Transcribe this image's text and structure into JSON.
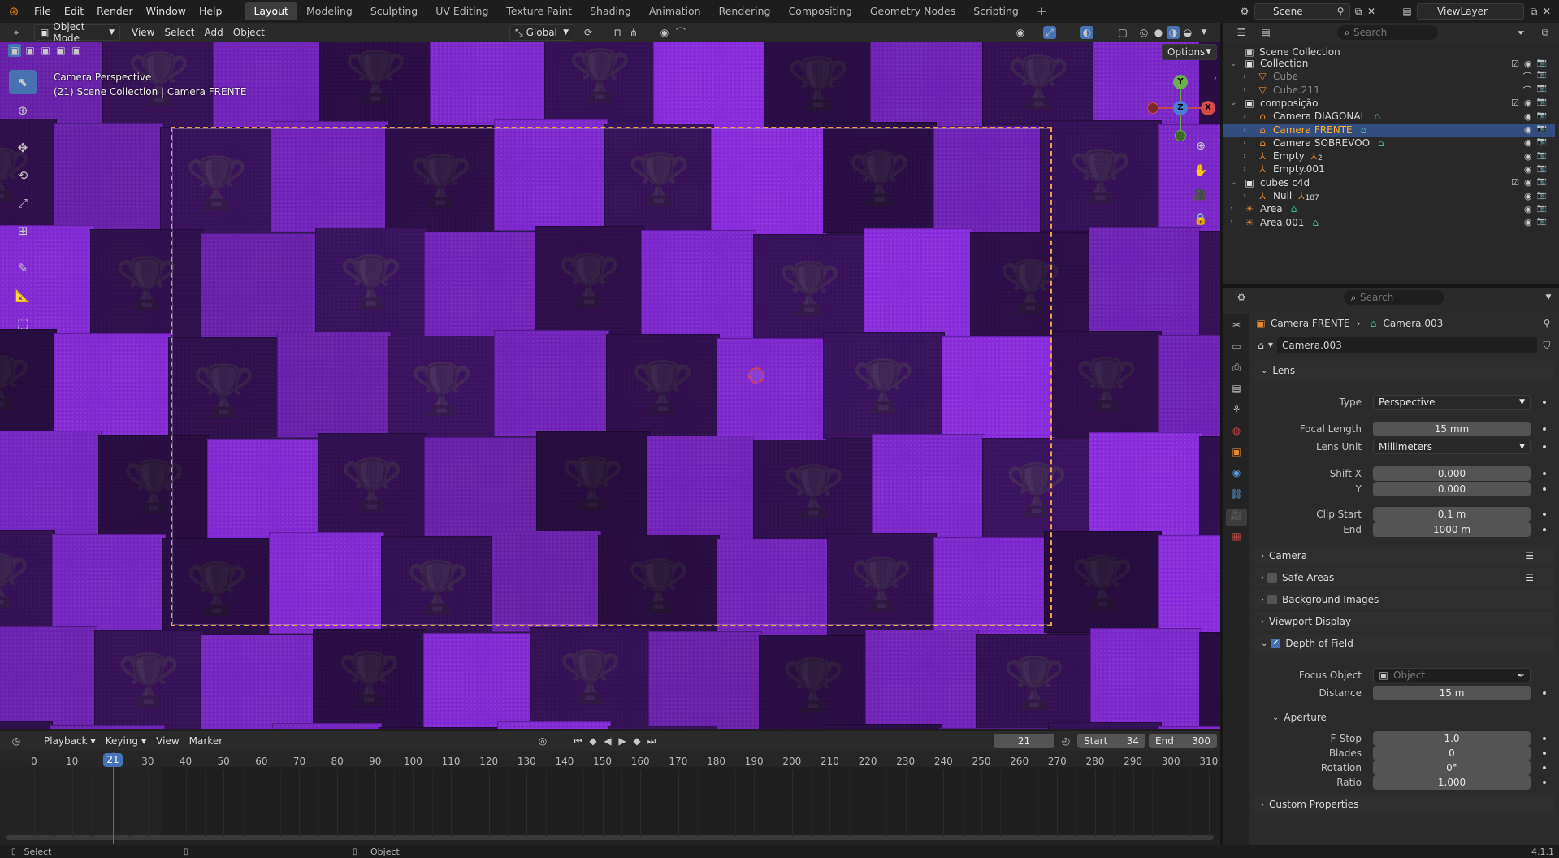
{
  "menubar": {
    "items": [
      "File",
      "Edit",
      "Render",
      "Window",
      "Help"
    ],
    "workspaces": [
      "Layout",
      "Modeling",
      "Sculpting",
      "UV Editing",
      "Texture Paint",
      "Shading",
      "Animation",
      "Rendering",
      "Compositing",
      "Geometry Nodes",
      "Scripting"
    ],
    "active_workspace": "Layout",
    "scene": "Scene",
    "view_layer": "ViewLayer"
  },
  "viewport_header": {
    "mode": "Object Mode",
    "menus": [
      "View",
      "Select",
      "Add",
      "Object"
    ],
    "transform_orientation": "Global",
    "options": "Options"
  },
  "viewport": {
    "overlay_title": "Camera Perspective",
    "overlay_subtitle": "(21) Scene Collection | Camera FRENTE",
    "gizmo_axes": [
      "X",
      "Y",
      "Z"
    ]
  },
  "outliner": {
    "search_placeholder": "Search",
    "root": "Scene Collection",
    "items": [
      {
        "label": "Collection",
        "depth": 1,
        "type": "collection"
      },
      {
        "label": "Cube",
        "depth": 2,
        "type": "mesh",
        "dim": true
      },
      {
        "label": "Cube.211",
        "depth": 2,
        "type": "mesh",
        "dim": true
      },
      {
        "label": "composição",
        "depth": 1,
        "type": "collection"
      },
      {
        "label": "Camera DIAGONAL",
        "depth": 2,
        "type": "camera"
      },
      {
        "label": "Camera FRENTE",
        "depth": 2,
        "type": "camera",
        "selected": true
      },
      {
        "label": "Camera SOBREVOO",
        "depth": 2,
        "type": "camera"
      },
      {
        "label": "Empty",
        "depth": 2,
        "type": "empty",
        "badge": "2"
      },
      {
        "label": "Empty.001",
        "depth": 2,
        "type": "empty"
      },
      {
        "label": "cubes c4d",
        "depth": 1,
        "type": "collection"
      },
      {
        "label": "Null",
        "depth": 2,
        "type": "empty",
        "badge": "187"
      },
      {
        "label": "Area",
        "depth": 1,
        "type": "light"
      },
      {
        "label": "Area.001",
        "depth": 1,
        "type": "light"
      }
    ]
  },
  "properties": {
    "search_placeholder": "Search",
    "breadcrumb_object": "Camera FRENTE",
    "breadcrumb_data": "Camera.003",
    "datablock": "Camera.003",
    "lens": {
      "title": "Lens",
      "type_label": "Type",
      "type_value": "Perspective",
      "focal_label": "Focal Length",
      "focal_value": "15 mm",
      "unit_label": "Lens Unit",
      "unit_value": "Millimeters",
      "shiftx_label": "Shift X",
      "shiftx_value": "0.000",
      "shifty_label": "Y",
      "shifty_value": "0.000",
      "clipstart_label": "Clip Start",
      "clipstart_value": "0.1 m",
      "clipend_label": "End",
      "clipend_value": "1000 m"
    },
    "panels": [
      "Camera",
      "Safe Areas",
      "Background Images",
      "Viewport Display"
    ],
    "dof": {
      "title": "Depth of Field",
      "focus_label": "Focus Object",
      "focus_placeholder": "Object",
      "distance_label": "Distance",
      "distance_value": "15 m",
      "aperture_title": "Aperture",
      "fstop_label": "F-Stop",
      "fstop_value": "1.0",
      "blades_label": "Blades",
      "blades_value": "0",
      "rotation_label": "Rotation",
      "rotation_value": "0°",
      "ratio_label": "Ratio",
      "ratio_value": "1.000"
    },
    "custom_props": "Custom Properties"
  },
  "timeline": {
    "menus": [
      "Playback",
      "Keying",
      "View",
      "Marker"
    ],
    "current_frame": "21",
    "start_label": "Start",
    "start_value": "34",
    "end_label": "End",
    "end_value": "300",
    "ruler": [
      "0",
      "10",
      "21",
      "30",
      "40",
      "50",
      "60",
      "70",
      "80",
      "90",
      "100",
      "110",
      "120",
      "130",
      "140",
      "150",
      "160",
      "170",
      "180",
      "190",
      "200",
      "210",
      "220",
      "230",
      "240",
      "250",
      "260",
      "270",
      "280",
      "290",
      "300",
      "310"
    ]
  },
  "statusbar": {
    "left": "Select",
    "middle": "Object",
    "version": "4.1.1"
  },
  "colors": {
    "accent_blue": "#4772b3",
    "selection_orange": "#f0a040",
    "cube_purple": "#8a2be2"
  }
}
